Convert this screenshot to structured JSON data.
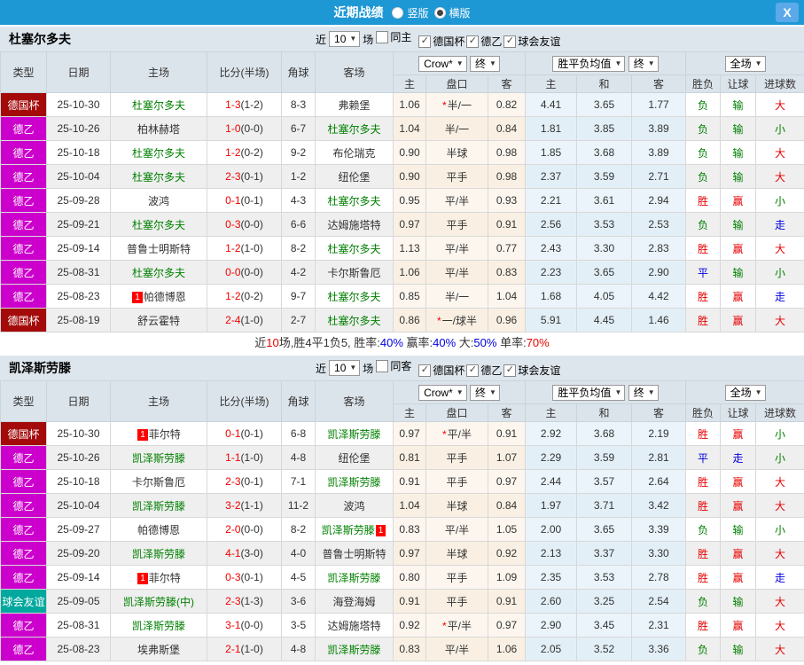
{
  "titlebar": {
    "title": "近期战绩",
    "radios": [
      {
        "label": "竖版",
        "selected": false
      },
      {
        "label": "横版",
        "selected": true
      }
    ],
    "close_label": "X"
  },
  "header": {
    "col_type": "类型",
    "col_date": "日期",
    "col_home": "主场",
    "col_score": "比分(半场)",
    "col_corner": "角球",
    "col_away": "客场",
    "odds_select": "Crow*",
    "odds_final": "终",
    "sub_home": "主",
    "sub_handicap": "盘口",
    "sub_away": "客",
    "avg_select": "胜平负均值",
    "avg_final": "终",
    "avg_home": "主",
    "avg_draw": "和",
    "avg_away": "客",
    "fullgame_select": "全场",
    "sub_result": "胜负",
    "sub_handicap_result": "让球",
    "sub_goals": "进球数"
  },
  "league_colors": {
    "德国杯": "#A40A0A",
    "德乙": "#CC00CC",
    "球会友谊": "#00A89E"
  },
  "result_colors": {
    "胜": "#E60000",
    "平": "#0000E0",
    "负": "#008000",
    "赢": "#E60000",
    "走": "#0000E0",
    "输": "#008000",
    "大": "#E60000",
    "小": "#008000"
  },
  "sections": [
    {
      "team": "杜塞尔多夫",
      "filter": {
        "prefix": "近",
        "count": "10",
        "suffix": "场",
        "checks": [
          {
            "label": "同主",
            "checked": false
          },
          {
            "label": "德国杯",
            "checked": true
          },
          {
            "label": "德乙",
            "checked": true
          },
          {
            "label": "球会友谊",
            "checked": true
          }
        ]
      },
      "rows": [
        {
          "league": "德国杯",
          "date": "25-10-30",
          "home": {
            "name": "杜塞尔多夫",
            "green": true,
            "card": null
          },
          "score": "1-3",
          "half": "(1-2)",
          "corner": "8-3",
          "away": {
            "name": "弗赖堡",
            "green": false,
            "card": null
          },
          "odds": [
            "1.06",
            "半/一",
            "0.82"
          ],
          "star": true,
          "avg": [
            "4.41",
            "3.65",
            "1.77"
          ],
          "results": [
            "负",
            "输",
            "大"
          ]
        },
        {
          "league": "德乙",
          "date": "25-10-26",
          "home": {
            "name": "柏林赫塔",
            "green": false,
            "card": null
          },
          "score": "1-0",
          "half": "(0-0)",
          "corner": "6-7",
          "away": {
            "name": "杜塞尔多夫",
            "green": true,
            "card": null
          },
          "odds": [
            "1.04",
            "半/一",
            "0.84"
          ],
          "star": false,
          "avg": [
            "1.81",
            "3.85",
            "3.89"
          ],
          "results": [
            "负",
            "输",
            "小"
          ]
        },
        {
          "league": "德乙",
          "date": "25-10-18",
          "home": {
            "name": "杜塞尔多夫",
            "green": true,
            "card": null
          },
          "score": "1-2",
          "half": "(0-2)",
          "corner": "9-2",
          "away": {
            "name": "布伦瑞克",
            "green": false,
            "card": null
          },
          "odds": [
            "0.90",
            "半球",
            "0.98"
          ],
          "star": false,
          "avg": [
            "1.85",
            "3.68",
            "3.89"
          ],
          "results": [
            "负",
            "输",
            "大"
          ]
        },
        {
          "league": "德乙",
          "date": "25-10-04",
          "home": {
            "name": "杜塞尔多夫",
            "green": true,
            "card": null
          },
          "score": "2-3",
          "half": "(0-1)",
          "corner": "1-2",
          "away": {
            "name": "纽伦堡",
            "green": false,
            "card": null
          },
          "odds": [
            "0.90",
            "平手",
            "0.98"
          ],
          "star": false,
          "avg": [
            "2.37",
            "3.59",
            "2.71"
          ],
          "results": [
            "负",
            "输",
            "大"
          ]
        },
        {
          "league": "德乙",
          "date": "25-09-28",
          "home": {
            "name": "波鸿",
            "green": false,
            "card": null
          },
          "score": "0-1",
          "half": "(0-1)",
          "corner": "4-3",
          "away": {
            "name": "杜塞尔多夫",
            "green": true,
            "card": null
          },
          "odds": [
            "0.95",
            "平/半",
            "0.93"
          ],
          "star": false,
          "avg": [
            "2.21",
            "3.61",
            "2.94"
          ],
          "results": [
            "胜",
            "赢",
            "小"
          ]
        },
        {
          "league": "德乙",
          "date": "25-09-21",
          "home": {
            "name": "杜塞尔多夫",
            "green": true,
            "card": null
          },
          "score": "0-3",
          "half": "(0-0)",
          "corner": "6-6",
          "away": {
            "name": "达姆施塔特",
            "green": false,
            "card": null
          },
          "odds": [
            "0.97",
            "平手",
            "0.91"
          ],
          "star": false,
          "avg": [
            "2.56",
            "3.53",
            "2.53"
          ],
          "results": [
            "负",
            "输",
            "走"
          ]
        },
        {
          "league": "德乙",
          "date": "25-09-14",
          "home": {
            "name": "普鲁士明斯特",
            "green": false,
            "card": null
          },
          "score": "1-2",
          "half": "(1-0)",
          "corner": "8-2",
          "away": {
            "name": "杜塞尔多夫",
            "green": true,
            "card": null
          },
          "odds": [
            "1.13",
            "平/半",
            "0.77"
          ],
          "star": false,
          "avg": [
            "2.43",
            "3.30",
            "2.83"
          ],
          "results": [
            "胜",
            "赢",
            "大"
          ]
        },
        {
          "league": "德乙",
          "date": "25-08-31",
          "home": {
            "name": "杜塞尔多夫",
            "green": true,
            "card": null
          },
          "score": "0-0",
          "half": "(0-0)",
          "corner": "4-2",
          "away": {
            "name": "卡尔斯鲁厄",
            "green": false,
            "card": null
          },
          "odds": [
            "1.06",
            "平/半",
            "0.83"
          ],
          "star": false,
          "avg": [
            "2.23",
            "3.65",
            "2.90"
          ],
          "results": [
            "平",
            "输",
            "小"
          ]
        },
        {
          "league": "德乙",
          "date": "25-08-23",
          "home": {
            "name": "帕德博恩",
            "green": false,
            "card": "before"
          },
          "score": "1-2",
          "half": "(0-2)",
          "corner": "9-7",
          "away": {
            "name": "杜塞尔多夫",
            "green": true,
            "card": null
          },
          "odds": [
            "0.85",
            "半/一",
            "1.04"
          ],
          "star": false,
          "avg": [
            "1.68",
            "4.05",
            "4.42"
          ],
          "results": [
            "胜",
            "赢",
            "走"
          ]
        },
        {
          "league": "德国杯",
          "date": "25-08-19",
          "home": {
            "name": "舒云霍特",
            "green": false,
            "card": null
          },
          "score": "2-4",
          "half": "(1-0)",
          "corner": "2-7",
          "away": {
            "name": "杜塞尔多夫",
            "green": true,
            "card": null
          },
          "odds": [
            "0.86",
            "一/球半",
            "0.96"
          ],
          "star": true,
          "avg": [
            "5.91",
            "4.45",
            "1.46"
          ],
          "results": [
            "胜",
            "赢",
            "大"
          ]
        }
      ],
      "summary_parts": [
        {
          "text": "近",
          "color": "#333333"
        },
        {
          "text": "10",
          "color": "#E60000"
        },
        {
          "text": "场,胜4平1负5, 胜率:",
          "color": "#333333"
        },
        {
          "text": "40%",
          "color": "#0000E0"
        },
        {
          "text": " 赢率:",
          "color": "#333333"
        },
        {
          "text": "40%",
          "color": "#0000E0"
        },
        {
          "text": " 大:",
          "color": "#333333"
        },
        {
          "text": "50%",
          "color": "#0000E0"
        },
        {
          "text": " 单率:",
          "color": "#333333"
        },
        {
          "text": "70%",
          "color": "#E60000"
        }
      ]
    },
    {
      "team": "凯泽斯劳滕",
      "filter": {
        "prefix": "近",
        "count": "10",
        "suffix": "场",
        "checks": [
          {
            "label": "同客",
            "checked": false
          },
          {
            "label": "德国杯",
            "checked": true
          },
          {
            "label": "德乙",
            "checked": true
          },
          {
            "label": "球会友谊",
            "checked": true
          }
        ]
      },
      "rows": [
        {
          "league": "德国杯",
          "date": "25-10-30",
          "home": {
            "name": "菲尔特",
            "green": false,
            "card": "before"
          },
          "score": "0-1",
          "half": "(0-1)",
          "corner": "6-8",
          "away": {
            "name": "凯泽斯劳滕",
            "green": true,
            "card": null
          },
          "odds": [
            "0.97",
            "平/半",
            "0.91"
          ],
          "star": true,
          "avg": [
            "2.92",
            "3.68",
            "2.19"
          ],
          "results": [
            "胜",
            "赢",
            "小"
          ]
        },
        {
          "league": "德乙",
          "date": "25-10-26",
          "home": {
            "name": "凯泽斯劳滕",
            "green": true,
            "card": null
          },
          "score": "1-1",
          "half": "(1-0)",
          "corner": "4-8",
          "away": {
            "name": "纽伦堡",
            "green": false,
            "card": null
          },
          "odds": [
            "0.81",
            "平手",
            "1.07"
          ],
          "star": false,
          "avg": [
            "2.29",
            "3.59",
            "2.81"
          ],
          "results": [
            "平",
            "走",
            "小"
          ]
        },
        {
          "league": "德乙",
          "date": "25-10-18",
          "home": {
            "name": "卡尔斯鲁厄",
            "green": false,
            "card": null
          },
          "score": "2-3",
          "half": "(0-1)",
          "corner": "7-1",
          "away": {
            "name": "凯泽斯劳滕",
            "green": true,
            "card": null
          },
          "odds": [
            "0.91",
            "平手",
            "0.97"
          ],
          "star": false,
          "avg": [
            "2.44",
            "3.57",
            "2.64"
          ],
          "results": [
            "胜",
            "赢",
            "大"
          ]
        },
        {
          "league": "德乙",
          "date": "25-10-04",
          "home": {
            "name": "凯泽斯劳滕",
            "green": true,
            "card": null
          },
          "score": "3-2",
          "half": "(1-1)",
          "corner": "11-2",
          "away": {
            "name": "波鸿",
            "green": false,
            "card": null
          },
          "odds": [
            "1.04",
            "半球",
            "0.84"
          ],
          "star": false,
          "avg": [
            "1.97",
            "3.71",
            "3.42"
          ],
          "results": [
            "胜",
            "赢",
            "大"
          ]
        },
        {
          "league": "德乙",
          "date": "25-09-27",
          "home": {
            "name": "帕德博恩",
            "green": false,
            "card": null
          },
          "score": "2-0",
          "half": "(0-0)",
          "corner": "8-2",
          "away": {
            "name": "凯泽斯劳滕",
            "green": true,
            "card": "after"
          },
          "odds": [
            "0.83",
            "平/半",
            "1.05"
          ],
          "star": false,
          "avg": [
            "2.00",
            "3.65",
            "3.39"
          ],
          "results": [
            "负",
            "输",
            "小"
          ]
        },
        {
          "league": "德乙",
          "date": "25-09-20",
          "home": {
            "name": "凯泽斯劳滕",
            "green": true,
            "card": null
          },
          "score": "4-1",
          "half": "(3-0)",
          "corner": "4-0",
          "away": {
            "name": "普鲁士明斯特",
            "green": false,
            "card": null
          },
          "odds": [
            "0.97",
            "半球",
            "0.92"
          ],
          "star": false,
          "avg": [
            "2.13",
            "3.37",
            "3.30"
          ],
          "results": [
            "胜",
            "赢",
            "大"
          ]
        },
        {
          "league": "德乙",
          "date": "25-09-14",
          "home": {
            "name": "菲尔特",
            "green": false,
            "card": "before"
          },
          "score": "0-3",
          "half": "(0-1)",
          "corner": "4-5",
          "away": {
            "name": "凯泽斯劳滕",
            "green": true,
            "card": null
          },
          "odds": [
            "0.80",
            "平手",
            "1.09"
          ],
          "star": false,
          "avg": [
            "2.35",
            "3.53",
            "2.78"
          ],
          "results": [
            "胜",
            "赢",
            "走"
          ]
        },
        {
          "league": "球会友谊",
          "date": "25-09-05",
          "home": {
            "name": "凯泽斯劳滕(中)",
            "green": true,
            "card": null
          },
          "score": "2-3",
          "half": "(1-3)",
          "corner": "3-6",
          "away": {
            "name": "海登海姆",
            "green": false,
            "card": null
          },
          "odds": [
            "0.91",
            "平手",
            "0.91"
          ],
          "star": false,
          "avg": [
            "2.60",
            "3.25",
            "2.54"
          ],
          "results": [
            "负",
            "输",
            "大"
          ]
        },
        {
          "league": "德乙",
          "date": "25-08-31",
          "home": {
            "name": "凯泽斯劳滕",
            "green": true,
            "card": null
          },
          "score": "3-1",
          "half": "(0-0)",
          "corner": "3-5",
          "away": {
            "name": "达姆施塔特",
            "green": false,
            "card": null
          },
          "odds": [
            "0.92",
            "平/半",
            "0.97"
          ],
          "star": true,
          "avg": [
            "2.90",
            "3.45",
            "2.31"
          ],
          "results": [
            "胜",
            "赢",
            "大"
          ]
        },
        {
          "league": "德乙",
          "date": "25-08-23",
          "home": {
            "name": "埃弗斯堡",
            "green": false,
            "card": null
          },
          "score": "2-1",
          "half": "(1-0)",
          "corner": "4-8",
          "away": {
            "name": "凯泽斯劳滕",
            "green": true,
            "card": null
          },
          "odds": [
            "0.83",
            "平/半",
            "1.06"
          ],
          "star": false,
          "avg": [
            "2.05",
            "3.52",
            "3.36"
          ],
          "results": [
            "负",
            "输",
            "大"
          ]
        }
      ],
      "summary_parts": []
    }
  ]
}
